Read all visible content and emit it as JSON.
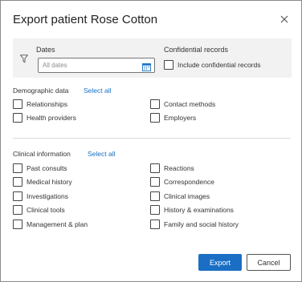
{
  "dialog": {
    "title": "Export patient Rose Cotton"
  },
  "filters": {
    "dates_label": "Dates",
    "dates_placeholder": "All dates",
    "confidential_label": "Confidential records",
    "include_confidential_label": "Include confidential records",
    "include_confidential_checked": false
  },
  "demographic": {
    "title": "Demographic data",
    "select_all": "Select all",
    "items": [
      "Relationships",
      "Contact methods",
      "Health providers",
      "Employers"
    ]
  },
  "clinical": {
    "title": "Clinical information",
    "select_all": "Select all",
    "items": [
      "Past consults",
      "Reactions",
      "Medical history",
      "Correspondence",
      "Investigations",
      "Clinical images",
      "Clinical tools",
      "History & examinations",
      "Management & plan",
      "Family and social history"
    ]
  },
  "buttons": {
    "export": "Export",
    "cancel": "Cancel"
  },
  "colors": {
    "accent": "#1a6fc4",
    "panel_bg": "#f2f2f2"
  },
  "icons": {
    "close": "close-icon",
    "filter": "filter-icon",
    "calendar": "calendar-icon"
  }
}
